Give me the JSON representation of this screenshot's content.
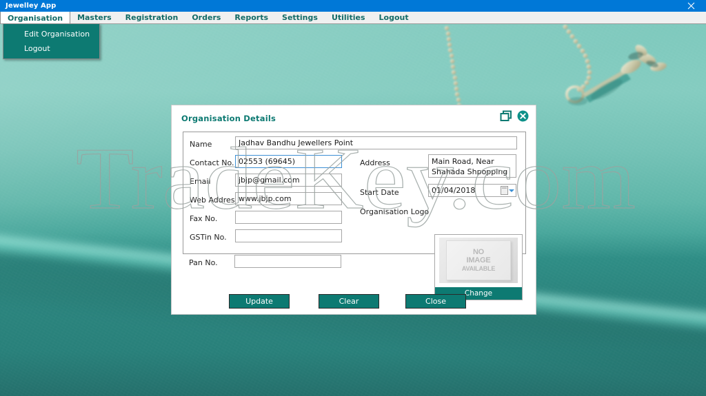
{
  "window": {
    "title": "Jewelley App",
    "close_icon": "close-icon"
  },
  "menubar": {
    "items": [
      {
        "label": "Organisation",
        "open": true
      },
      {
        "label": "Masters",
        "open": false
      },
      {
        "label": "Registration",
        "open": false
      },
      {
        "label": "Orders",
        "open": false
      },
      {
        "label": "Reports",
        "open": false
      },
      {
        "label": "Settings",
        "open": false
      },
      {
        "label": "Utilities",
        "open": false
      },
      {
        "label": "Logout",
        "open": false
      }
    ]
  },
  "dropdown": {
    "items": [
      {
        "label": "Edit Organisation"
      },
      {
        "label": "Logout"
      }
    ]
  },
  "watermark": {
    "text": "TradeKey.com"
  },
  "dialog": {
    "title": "Organisation Details",
    "restore_icon": "restore-window-icon",
    "close_icon": "close-circle-icon",
    "fields": {
      "name": {
        "label": "Name",
        "value": "Jadhav Bandhu Jewellers Point",
        "placeholder": ""
      },
      "contact": {
        "label": "Contact No.",
        "value": "02553 (69645)",
        "placeholder": "",
        "focused": true
      },
      "email": {
        "label": "Email",
        "value": "jbjp@gmail.com",
        "placeholder": ""
      },
      "web": {
        "label": "Web Address",
        "value": "www.jbjp.com",
        "placeholder": ""
      },
      "fax": {
        "label": "Fax No.",
        "value": "",
        "placeholder": ""
      },
      "gstin": {
        "label": "GSTin No.",
        "value": "",
        "placeholder": ""
      },
      "pan": {
        "label": "Pan No.",
        "value": "",
        "placeholder": ""
      },
      "address": {
        "label": "Address",
        "value": "Main Road, Near\nShahada Shpopping",
        "placeholder": ""
      },
      "start_date": {
        "label": "Start Date",
        "value": "01/04/2018",
        "placeholder": ""
      },
      "logo": {
        "label": "Organisation Logo",
        "placeholder_line1": "NO",
        "placeholder_line2": "IMAGE",
        "placeholder_line3": "AVAILABLE",
        "change_label": "Change"
      }
    },
    "buttons": {
      "update": "Update",
      "clear": "Clear",
      "close": "Close"
    }
  },
  "colors": {
    "accent_teal": "#0d7a72",
    "title_blue": "#0078d7",
    "menu_text": "#136b66",
    "focus_blue": "#3b8fd4",
    "background_teal": "#3a9e94"
  }
}
